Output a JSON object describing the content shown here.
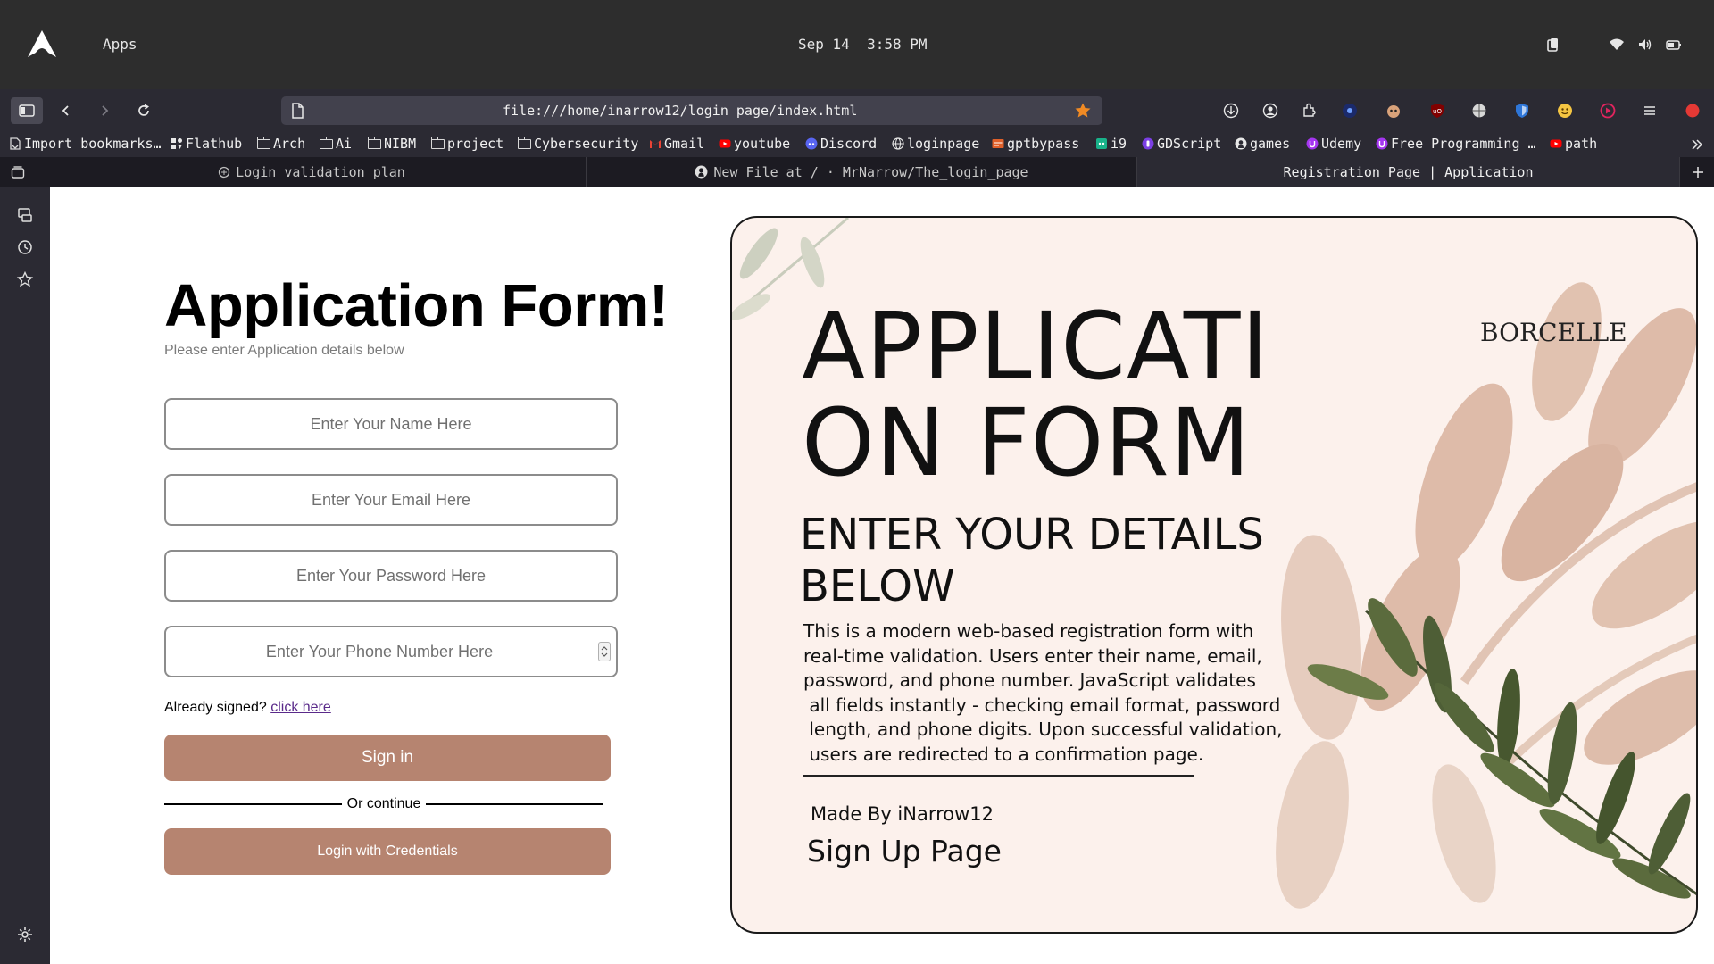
{
  "topbar": {
    "apps_label": "Apps",
    "date": "Sep 14",
    "time": "3:58 PM"
  },
  "browser": {
    "url": "file:///home/inarrow12/login page/index.html",
    "bookmarks": [
      {
        "label": "Import bookmarks…",
        "icon": "import-icon"
      },
      {
        "label": "Flathub",
        "icon": "flathub-icon"
      },
      {
        "label": "Arch",
        "icon": "folder-icon"
      },
      {
        "label": "Ai",
        "icon": "folder-icon"
      },
      {
        "label": "NIBM",
        "icon": "folder-icon"
      },
      {
        "label": "project",
        "icon": "folder-icon"
      },
      {
        "label": "Cybersecurity",
        "icon": "folder-icon"
      },
      {
        "label": "Gmail",
        "icon": "gmail-icon"
      },
      {
        "label": "youtube",
        "icon": "youtube-icon"
      },
      {
        "label": "Discord",
        "icon": "discord-icon"
      },
      {
        "label": "loginpage",
        "icon": "globe-icon"
      },
      {
        "label": "gptbypass",
        "icon": "gptbypass-icon"
      },
      {
        "label": "i9",
        "icon": "i9-icon"
      },
      {
        "label": "GDScript",
        "icon": "gdscript-icon"
      },
      {
        "label": "games",
        "icon": "github-icon"
      },
      {
        "label": "Udemy",
        "icon": "udemy-icon"
      },
      {
        "label": "Free Programming …",
        "icon": "udemy-icon"
      },
      {
        "label": "path",
        "icon": "youtube-icon"
      }
    ],
    "tabs": [
      {
        "label": "Login validation plan",
        "icon": "chatgpt-icon",
        "active": false
      },
      {
        "label": "New File at / · MrNarrow/The_login_page",
        "icon": "github-icon",
        "active": false
      },
      {
        "label": "Registration Page | Application",
        "icon": "",
        "active": true
      }
    ]
  },
  "form": {
    "title": "Application Form!",
    "subtitle": "Please enter Application details below",
    "name_placeholder": "Enter Your Name Here",
    "email_placeholder": "Enter Your Email Here",
    "password_placeholder": "Enter Your Password Here",
    "phone_placeholder": "Enter Your Phone Number Here",
    "already_text": "Already signed?",
    "click_here": "click here",
    "signin_label": "Sign in",
    "or_continue": "Or continue",
    "credentials_label": "Login with Credentials"
  },
  "poster": {
    "title_line1": "APPLICATI",
    "title_line2": "ON FORM",
    "sub_line1": "ENTER YOUR DETAILS",
    "sub_line2": "BELOW",
    "brand": "BORCELLE",
    "description": [
      "This is a modern web-based registration form with",
      "real-time validation. Users enter their name, email,",
      "password, and phone number. JavaScript validates",
      " all fields instantly - checking email format, password",
      " length, and phone digits. Upon successful validation,",
      " users are redirected to a confirmation page."
    ],
    "made_by": "Made By iNarrow12",
    "signup_page": "Sign Up Page"
  },
  "colors": {
    "button_brown": "#b68470",
    "poster_bg": "#fcf1ec",
    "leaf_tan": "#d9b3a0",
    "leaf_green": "#4e5e36",
    "bookmark_star": "#f08a24"
  }
}
